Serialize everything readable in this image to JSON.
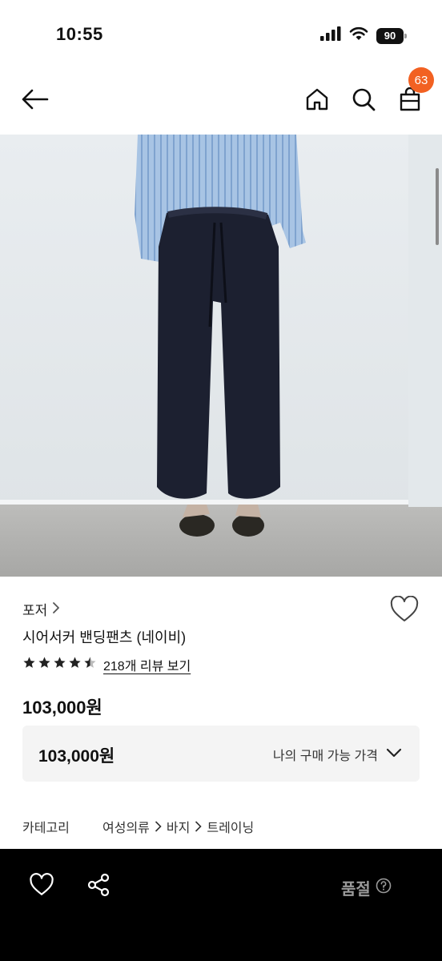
{
  "status_bar": {
    "time": "10:55",
    "battery": "90",
    "icons": [
      "cellular-signal-icon",
      "wifi-icon",
      "battery-icon"
    ]
  },
  "header": {
    "icons": [
      "back-arrow-icon",
      "home-icon",
      "search-icon",
      "shopping-bag-icon"
    ],
    "cart_count": "63"
  },
  "product": {
    "image_alt": "",
    "brand": "포저",
    "title": "시어서커 밴딩팬츠 (네이비)",
    "rating": 4.5,
    "review_link": "218개 리뷰 보기",
    "price": "103,000원"
  },
  "price_box": {
    "amount": "103,000원",
    "toggle_label": "나의 구매 가능 가격"
  },
  "category": {
    "label": "카테고리",
    "path": [
      "여성의류",
      "바지",
      "트레이닝"
    ]
  },
  "bottom_bar": {
    "icons": [
      "heart-icon",
      "share-icon",
      "help-circle-icon"
    ],
    "status_label": "품절"
  },
  "colors": {
    "badge": "#f26122",
    "bottom_bar_bg": "#000000",
    "price_box_bg": "#f4f4f4",
    "soldout_text": "#9a9a9a"
  }
}
